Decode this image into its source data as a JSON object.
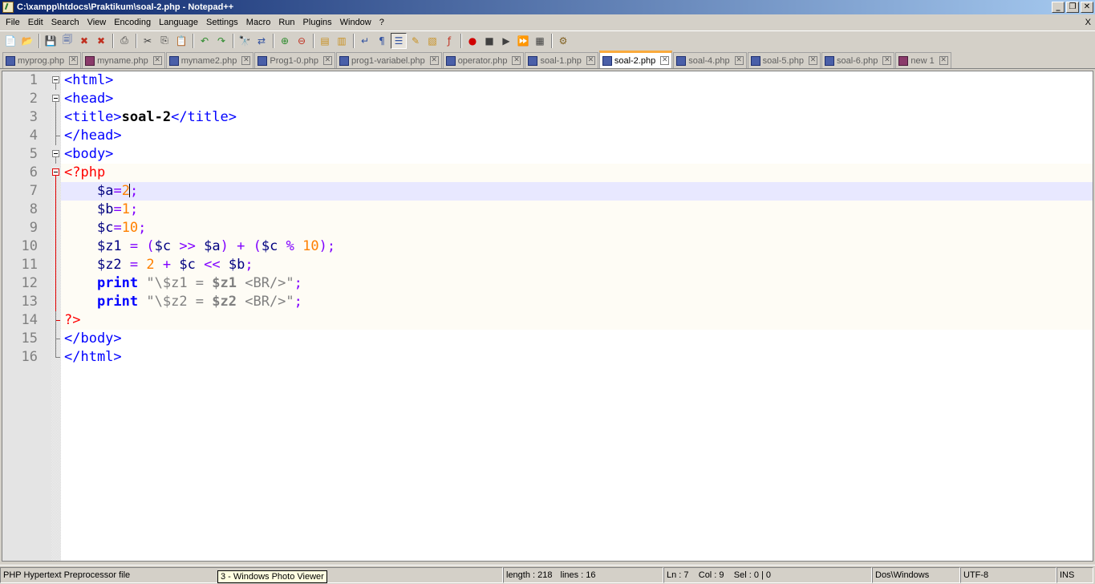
{
  "window": {
    "title": "C:\\xampp\\htdocs\\Praktikum\\soal-2.php - Notepad++",
    "minimize": "_",
    "restore": "❐",
    "close": "✕"
  },
  "menu": {
    "items": [
      "File",
      "Edit",
      "Search",
      "View",
      "Encoding",
      "Language",
      "Settings",
      "Macro",
      "Run",
      "Plugins",
      "Window",
      "?"
    ],
    "close_doc": "X"
  },
  "toolbar": {
    "icons": [
      {
        "name": "new-file-icon",
        "glyph": "📄",
        "color": "#2a8a2a"
      },
      {
        "name": "open-file-icon",
        "glyph": "📂",
        "color": "#c89020"
      },
      {
        "name": "save-icon",
        "glyph": "💾",
        "color": "#3050a0"
      },
      {
        "name": "save-all-icon",
        "glyph": "🗐",
        "color": "#3050a0"
      },
      {
        "name": "close-file-icon",
        "glyph": "✖",
        "color": "#c03020"
      },
      {
        "name": "close-all-icon",
        "glyph": "✖",
        "color": "#c03020"
      },
      {
        "name": "print-icon",
        "glyph": "⎙",
        "color": "#404040"
      },
      {
        "name": "cut-icon",
        "glyph": "✂",
        "color": "#404040"
      },
      {
        "name": "copy-icon",
        "glyph": "⎘",
        "color": "#404040"
      },
      {
        "name": "paste-icon",
        "glyph": "📋",
        "color": "#806020"
      },
      {
        "name": "undo-icon",
        "glyph": "↶",
        "color": "#2a8a2a"
      },
      {
        "name": "redo-icon",
        "glyph": "↷",
        "color": "#2a8a2a"
      },
      {
        "name": "find-icon",
        "glyph": "🔭",
        "color": "#404040"
      },
      {
        "name": "replace-icon",
        "glyph": "⇄",
        "color": "#3050a0"
      },
      {
        "name": "zoom-in-icon",
        "glyph": "⊕",
        "color": "#2a8a2a"
      },
      {
        "name": "zoom-out-icon",
        "glyph": "⊖",
        "color": "#c03020"
      },
      {
        "name": "sync-vertical-icon",
        "glyph": "▤",
        "color": "#c89020"
      },
      {
        "name": "sync-horizontal-icon",
        "glyph": "▥",
        "color": "#c89020"
      },
      {
        "name": "word-wrap-icon",
        "glyph": "↵",
        "color": "#3050a0"
      },
      {
        "name": "show-all-chars-icon",
        "glyph": "¶",
        "color": "#3050a0"
      },
      {
        "name": "indent-guide-icon",
        "glyph": "☰",
        "color": "#3050a0"
      },
      {
        "name": "user-language-icon",
        "glyph": "✎",
        "color": "#c89020"
      },
      {
        "name": "doc-map-icon",
        "glyph": "▧",
        "color": "#c89020"
      },
      {
        "name": "function-list-icon",
        "glyph": "ƒ",
        "color": "#c03020"
      },
      {
        "name": "record-macro-icon",
        "glyph": "●",
        "color": "#d00000"
      },
      {
        "name": "stop-macro-icon",
        "glyph": "■",
        "color": "#404040"
      },
      {
        "name": "play-macro-icon",
        "glyph": "▶",
        "color": "#404040"
      },
      {
        "name": "play-multiple-icon",
        "glyph": "⏩",
        "color": "#3050a0"
      },
      {
        "name": "save-macro-icon",
        "glyph": "▦",
        "color": "#404040"
      },
      {
        "name": "run-icon",
        "glyph": "⚙",
        "color": "#806020"
      }
    ]
  },
  "tabs": [
    {
      "label": "myprog.php",
      "color": "blue",
      "active": false
    },
    {
      "label": "myname.php",
      "color": "mag",
      "active": false
    },
    {
      "label": "myname2.php",
      "color": "blue",
      "active": false
    },
    {
      "label": "Prog1-0.php",
      "color": "blue",
      "active": false
    },
    {
      "label": "prog1-variabel.php",
      "color": "blue",
      "active": false
    },
    {
      "label": "operator.php",
      "color": "blue",
      "active": false
    },
    {
      "label": "soal-1.php",
      "color": "blue",
      "active": false
    },
    {
      "label": "soal-2.php",
      "color": "blue",
      "active": true
    },
    {
      "label": "soal-4.php",
      "color": "blue",
      "active": false
    },
    {
      "label": "soal-5.php",
      "color": "blue",
      "active": false
    },
    {
      "label": "soal-6.php",
      "color": "blue",
      "active": false
    },
    {
      "label": "new 1",
      "color": "new",
      "active": false
    }
  ],
  "editor": {
    "current_line": 7,
    "lines": [
      [
        [
          "tag",
          "<html>"
        ]
      ],
      [
        [
          "tag",
          "<head>"
        ]
      ],
      [
        [
          "tag",
          "<title>"
        ],
        [
          "bold",
          "soal-2"
        ],
        [
          "tag",
          "</title>"
        ]
      ],
      [
        [
          "tag",
          "</head>"
        ]
      ],
      [
        [
          "tag",
          "<body>"
        ]
      ],
      [
        [
          "php",
          "<?php"
        ]
      ],
      [
        [
          "",
          "    "
        ],
        [
          "var",
          "$a"
        ],
        [
          "op",
          "="
        ],
        [
          "num",
          "2"
        ],
        [
          "caret",
          ""
        ],
        [
          "op",
          ";"
        ]
      ],
      [
        [
          "",
          "    "
        ],
        [
          "var",
          "$b"
        ],
        [
          "op",
          "="
        ],
        [
          "num",
          "1"
        ],
        [
          "op",
          ";"
        ]
      ],
      [
        [
          "",
          "    "
        ],
        [
          "var",
          "$c"
        ],
        [
          "op",
          "="
        ],
        [
          "num",
          "10"
        ],
        [
          "op",
          ";"
        ]
      ],
      [
        [
          "",
          "    "
        ],
        [
          "var",
          "$z1"
        ],
        [
          "",
          " "
        ],
        [
          "op",
          "="
        ],
        [
          "",
          " "
        ],
        [
          "op",
          "("
        ],
        [
          "var",
          "$c"
        ],
        [
          "",
          " "
        ],
        [
          "op",
          ">>"
        ],
        [
          "",
          " "
        ],
        [
          "var",
          "$a"
        ],
        [
          "op",
          ")"
        ],
        [
          "",
          " "
        ],
        [
          "op",
          "+"
        ],
        [
          "",
          " "
        ],
        [
          "op",
          "("
        ],
        [
          "var",
          "$c"
        ],
        [
          "",
          " "
        ],
        [
          "op",
          "%"
        ],
        [
          "",
          " "
        ],
        [
          "num",
          "10"
        ],
        [
          "op",
          ");"
        ]
      ],
      [
        [
          "",
          "    "
        ],
        [
          "var",
          "$z2"
        ],
        [
          "",
          " "
        ],
        [
          "op",
          "="
        ],
        [
          "",
          " "
        ],
        [
          "num",
          "2"
        ],
        [
          "",
          " "
        ],
        [
          "op",
          "+"
        ],
        [
          "",
          " "
        ],
        [
          "var",
          "$c"
        ],
        [
          "",
          " "
        ],
        [
          "op",
          "<<"
        ],
        [
          "",
          " "
        ],
        [
          "var",
          "$b"
        ],
        [
          "op",
          ";"
        ]
      ],
      [
        [
          "",
          "    "
        ],
        [
          "kw",
          "print"
        ],
        [
          "",
          " "
        ],
        [
          "str",
          "\"\\$z1 = "
        ],
        [
          "strvar",
          "$z1"
        ],
        [
          "str",
          " <BR/>\""
        ],
        [
          "op",
          ";"
        ]
      ],
      [
        [
          "",
          "    "
        ],
        [
          "kw",
          "print"
        ],
        [
          "",
          " "
        ],
        [
          "str",
          "\"\\$z2 = "
        ],
        [
          "strvar",
          "$z2"
        ],
        [
          "str",
          " <BR/>\""
        ],
        [
          "op",
          ";"
        ]
      ],
      [
        [
          "php",
          "?>"
        ]
      ],
      [
        [
          "tag",
          "</body>"
        ]
      ],
      [
        [
          "tag",
          "</html>"
        ]
      ]
    ]
  },
  "statusbar": {
    "filetype": "PHP Hypertext Preprocessor file",
    "length": "length : 218",
    "lines": "lines : 16",
    "position": "Ln : 7    Col : 9    Sel : 0 | 0",
    "eol": "Dos\\Windows",
    "encoding": "UTF-8",
    "mode": "INS"
  },
  "tooltip": "3 - Windows Photo Viewer"
}
